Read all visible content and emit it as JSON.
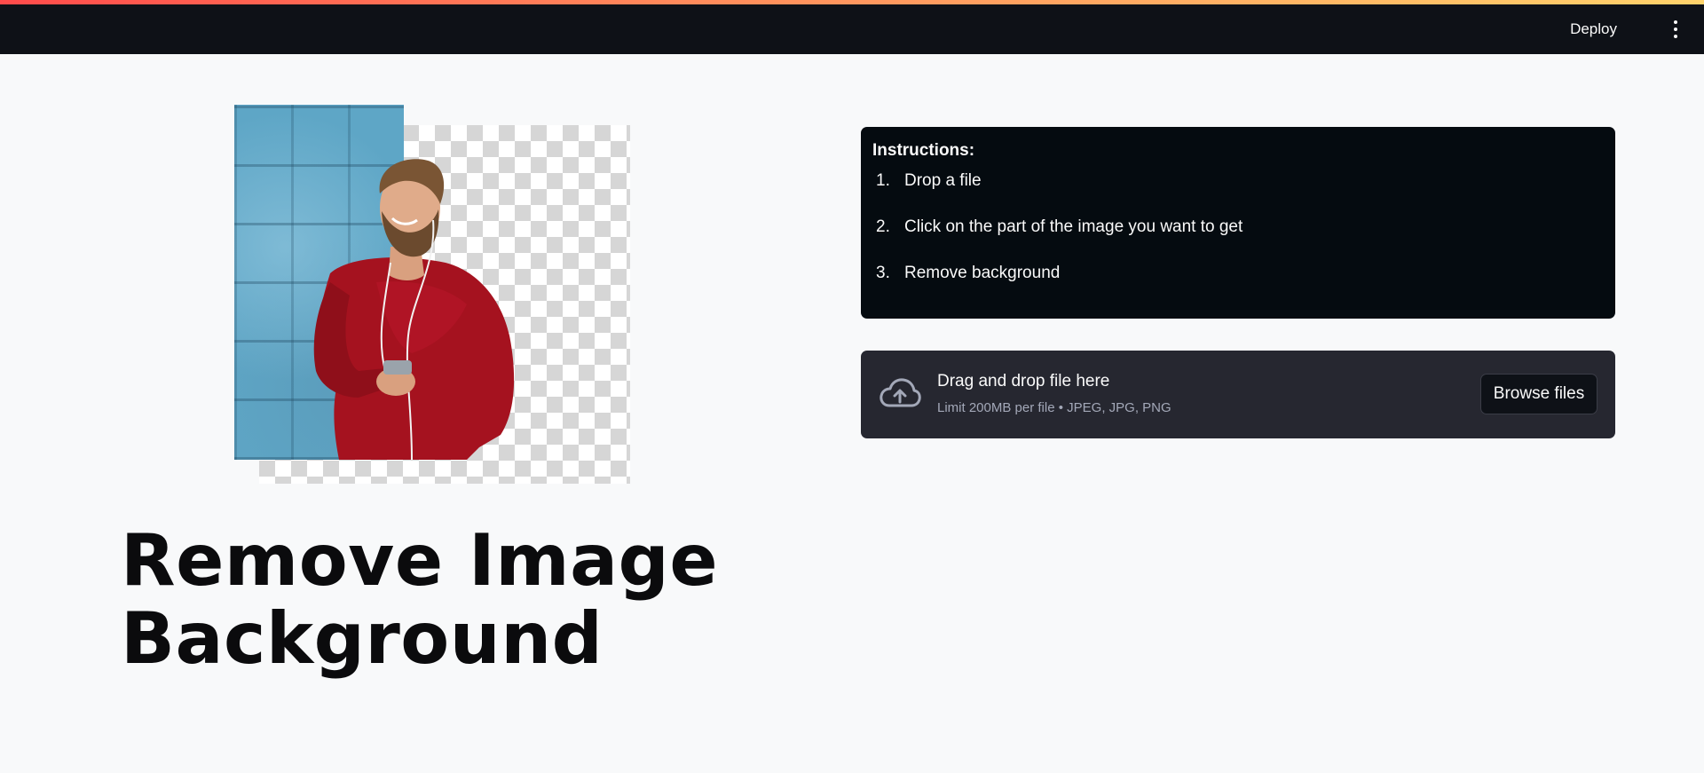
{
  "header": {
    "deploy_label": "Deploy",
    "menu_icon": "vertical-ellipsis-icon"
  },
  "hero": {
    "image_description_icon": "person-cutout-image"
  },
  "main": {
    "title": "Remove Image Background"
  },
  "instructions": {
    "heading": "Instructions:",
    "steps": [
      {
        "num": "1.",
        "text": "Drop a file"
      },
      {
        "num": "2.",
        "text": "Click on the part of the image you want to get"
      },
      {
        "num": "3.",
        "text": "Remove background"
      }
    ]
  },
  "uploader": {
    "icon": "cloud-upload-icon",
    "drop_text": "Drag and drop file here",
    "limit_text": "Limit 200MB per file • JPEG, JPG, PNG",
    "browse_label": "Browse files"
  },
  "colors": {
    "accent_stripe_start": "#ff4b4b",
    "accent_stripe_end": "#ffd36b",
    "header_bg": "#0e1117",
    "instructions_bg": "#050b10",
    "uploader_bg": "#262730"
  }
}
